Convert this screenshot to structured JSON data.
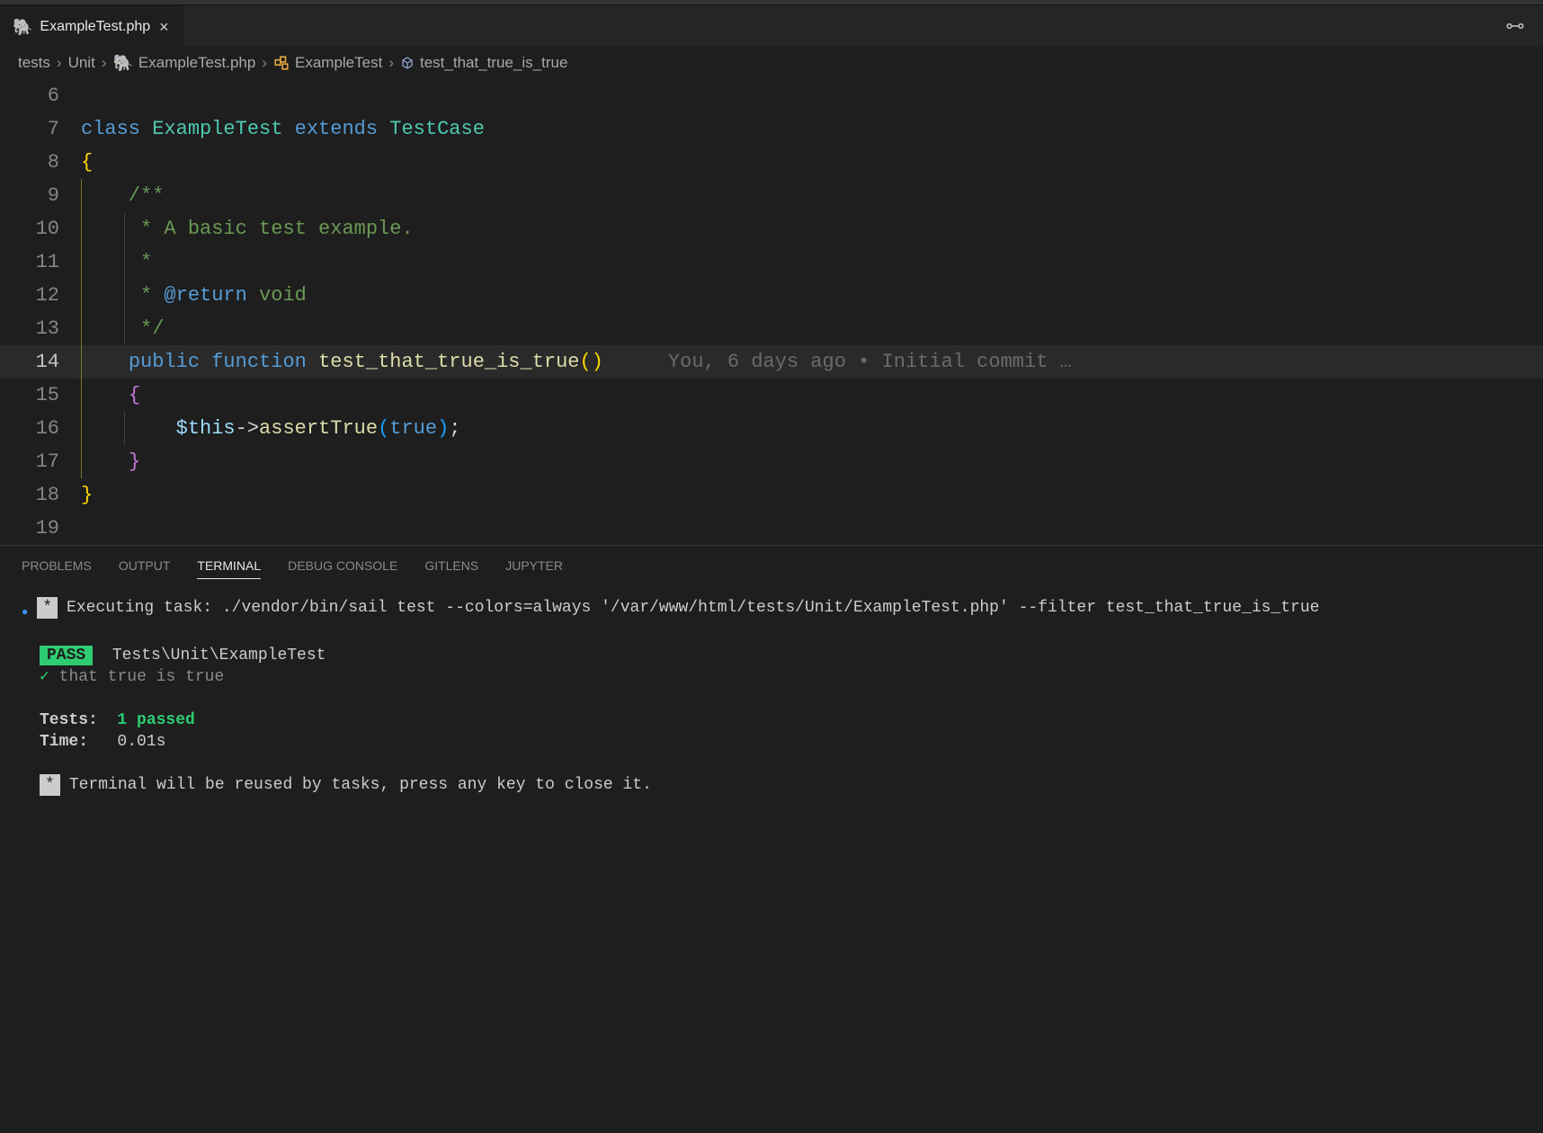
{
  "tab": {
    "filename": "ExampleTest.php"
  },
  "breadcrumb": {
    "p0": "tests",
    "p1": "Unit",
    "p2": "ExampleTest.php",
    "p3": "ExampleTest",
    "p4": "test_that_true_is_true"
  },
  "code": {
    "lines": [
      "6",
      "7",
      "8",
      "9",
      "10",
      "11",
      "12",
      "13",
      "14",
      "15",
      "16",
      "17",
      "18",
      "19"
    ],
    "l7_kw1": "class",
    "l7_cls": "ExampleTest",
    "l7_kw2": "extends",
    "l7_base": "TestCase",
    "l8_brace": "{",
    "l9_c": "/**",
    "l10_c": " * A basic test example.",
    "l11_c": " *",
    "l12_c1": " * ",
    "l12_tag": "@return",
    "l12_c2": " void",
    "l13_c": " */",
    "l14_kw1": "public",
    "l14_kw2": "function",
    "l14_fn": "test_that_true_is_true",
    "l14_par": "()",
    "l14_blame": "You, 6 days ago • Initial commit …",
    "l15_brace": "{",
    "l16_var": "$this",
    "l16_arrow": "->",
    "l16_fn": "assertTrue",
    "l16_lp": "(",
    "l16_arg": "true",
    "l16_rp": ")",
    "l16_sc": ";",
    "l17_brace": "}",
    "l18_brace": "}"
  },
  "panel": {
    "tabs": {
      "problems": "PROBLEMS",
      "output": "OUTPUT",
      "terminal": "TERMINAL",
      "debug": "DEBUG CONSOLE",
      "gitlens": "GITLENS",
      "jupyter": "JUPYTER"
    }
  },
  "terminal": {
    "task_star": "*",
    "task_prefix": "Executing task: ",
    "task_cmd": "./vendor/bin/sail test --colors=always '/var/www/html/tests/Unit/ExampleTest.php' --filter test_that_true_is_true",
    "pass_label": "PASS",
    "pass_suite": "Tests\\Unit\\ExampleTest",
    "check": "✓",
    "test_name": "that true is true",
    "tests_label": "Tests:",
    "tests_val": "1 passed",
    "time_label": "Time:",
    "time_val": "0.01s",
    "reuse_star": "*",
    "reuse_msg": "Terminal will be reused by tasks, press any key to close it."
  }
}
